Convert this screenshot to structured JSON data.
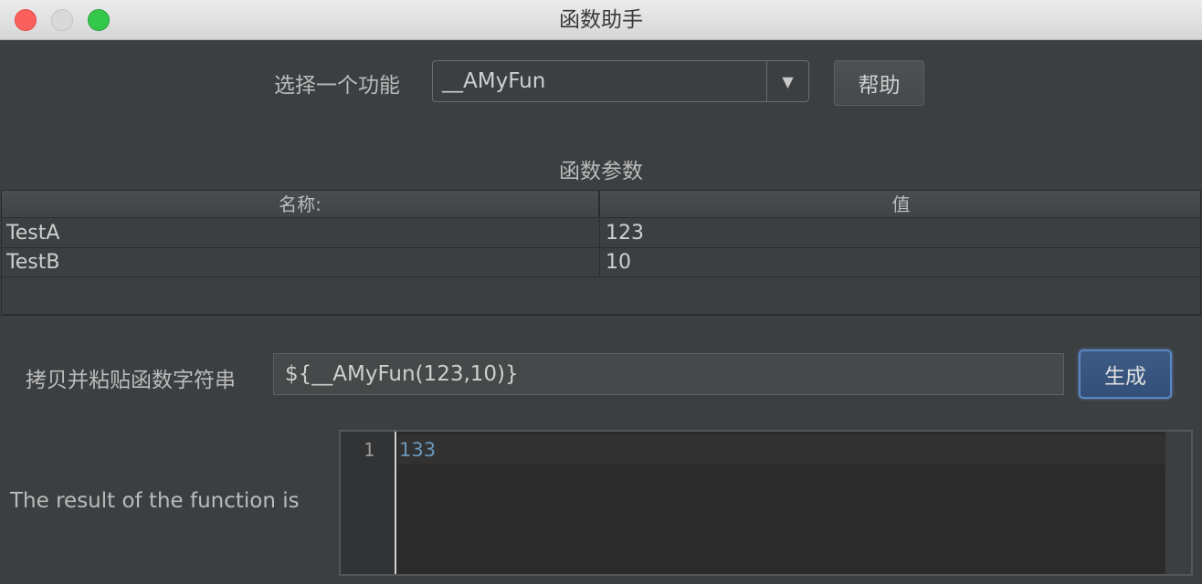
{
  "window": {
    "title": "函数助手"
  },
  "function_select": {
    "label": "选择一个功能",
    "value": "__AMyFun",
    "help_label": "帮助"
  },
  "params": {
    "title": "函数参数",
    "columns": [
      "名称:",
      "值"
    ],
    "rows": [
      {
        "name": "TestA",
        "value": "123"
      },
      {
        "name": "TestB",
        "value": "10"
      }
    ]
  },
  "copy": {
    "label": "拷贝并粘贴函数字符串",
    "value": "${__AMyFun(123,10)}",
    "generate_label": "生成"
  },
  "result": {
    "label": "The result of the function is",
    "line_number": "1",
    "text": "133"
  },
  "icons": {
    "dropdown": "chevron-down-icon"
  }
}
